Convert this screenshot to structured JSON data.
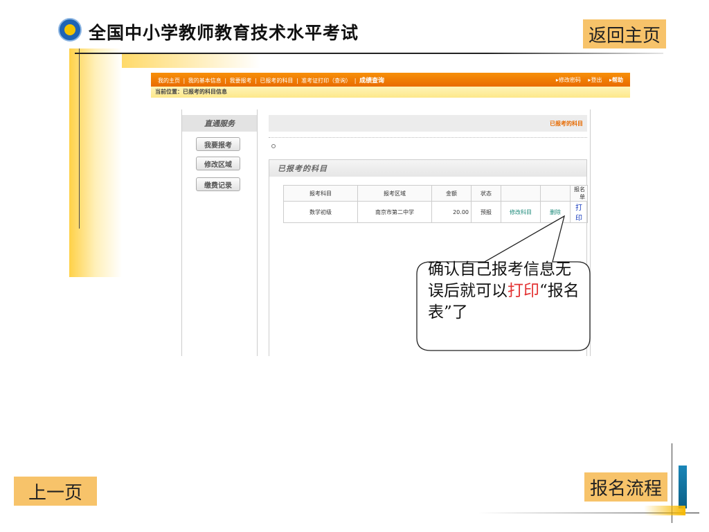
{
  "slide": {
    "title": "全国中小学教师教育技术水平考试",
    "home_button": "返回主页",
    "prev_button": "上一页",
    "flow_button": "报名流程"
  },
  "navbar": {
    "links": [
      "我的主页",
      "我的基本信息",
      "我要报考",
      "已报考的科目",
      "准考证打印（查询）"
    ],
    "highlight": "成绩查询",
    "separator": "|",
    "right": [
      "▸修改密码",
      "▸登出",
      "▸帮助"
    ]
  },
  "breadcrumb": "当前位置：已报考的科目信息",
  "sidebar": {
    "title": "直通服务",
    "buttons": [
      "我要报考",
      "修改区域",
      "缴费记录"
    ]
  },
  "content": {
    "header_label": "已报考的科目",
    "panel_title": "已报考的科目",
    "table": {
      "headers": [
        "报考科目",
        "报考区域",
        "金额",
        "状态",
        "",
        "",
        "报名单"
      ],
      "rows": [
        [
          "数学初级",
          "南京市第二中学",
          "20.00",
          "预报",
          "修改科目",
          "删除",
          "打印"
        ]
      ]
    }
  },
  "callout": {
    "text_before": "确认自己报考信息无误后就可以",
    "highlight": "打印",
    "text_after": "“报名表”了"
  },
  "colors": {
    "nav_orange": "#f7900a",
    "button_tan": "#f7c36a",
    "highlight_red": "#e33333",
    "link_blue": "#1c3fbf",
    "link_green": "#1c8a7a"
  }
}
